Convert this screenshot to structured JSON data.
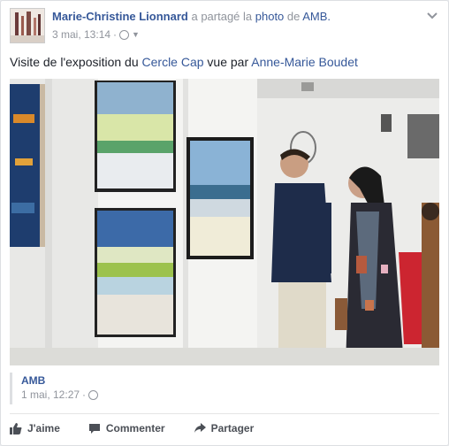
{
  "post": {
    "author": "Marie-Christine Lionnard",
    "shared_text": " a partagé la ",
    "photo_link": "photo",
    "de_text": " de ",
    "source_link": "AMB.",
    "date": "3 mai, 13:14",
    "dot": "·",
    "text_pre": "Visite de l'exposition du ",
    "text_link1": "Cercle Cap",
    "text_mid": " vue par ",
    "text_link2": "Anne-Marie Boudet"
  },
  "shared": {
    "name": "AMB",
    "date": "1 mai, 12:27",
    "dot": "·"
  },
  "actions": {
    "like": "J'aime",
    "comment": "Commenter",
    "share": "Partager"
  },
  "icons": [
    "globe-icon",
    "dropdown-arrow-icon",
    "chevron-down-icon",
    "like-icon",
    "comment-icon",
    "share-icon"
  ]
}
